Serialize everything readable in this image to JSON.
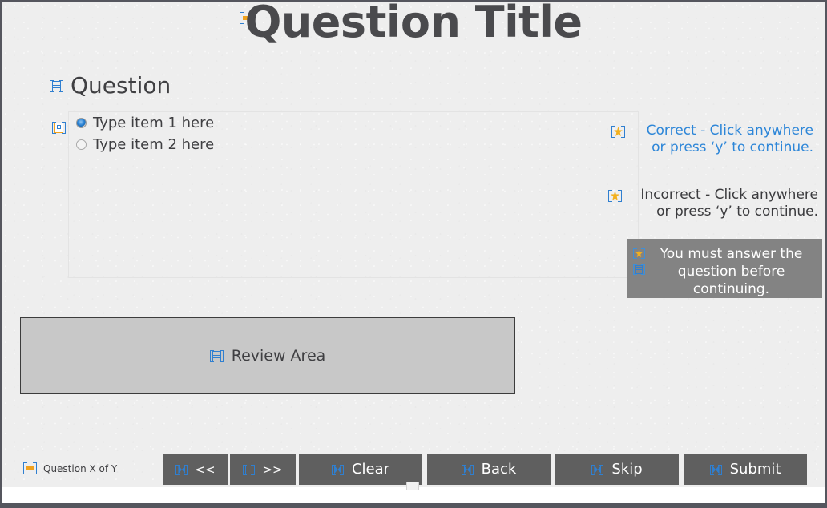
{
  "slide": {
    "title": "Question Title",
    "title_icon": "shape-object-icon"
  },
  "question": {
    "heading": "Question",
    "heading_icon": "text-block-icon",
    "answer_icon": "radio-group-icon",
    "choices": [
      {
        "label": "Type item 1 here",
        "selected": true
      },
      {
        "label": "Type item 2 here",
        "selected": false
      }
    ]
  },
  "feedback": {
    "correct": {
      "line1": "Correct - Click anywhere",
      "line2": "or press ‘y’ to continue.",
      "color": "#2d86d8",
      "icon": "caption-star-icon"
    },
    "incorrect": {
      "line1": "Incorrect - Click anywhere",
      "line2": "or press ‘y’ to continue.",
      "color": "#3b3b3e",
      "icon": "caption-star-icon"
    },
    "must_answer": {
      "line1": "You must answer the",
      "line2": "question before",
      "line3": "continuing.",
      "background": "#838383",
      "text_color": "#ffffff",
      "icon_star": "caption-star-icon",
      "icon_text": "text-block-icon"
    }
  },
  "review": {
    "label": "Review Area",
    "icon": "text-block-icon",
    "background": "#c8c8c8"
  },
  "footer": {
    "counter": "Question X of Y",
    "counter_icon": "shape-object-icon",
    "buttons": [
      {
        "label": "<<",
        "name": "prev",
        "icon": "button-object-icon"
      },
      {
        "label": ">>",
        "name": "next",
        "icon": "button-object-icon-hollow"
      },
      {
        "label": "Clear",
        "name": "clear",
        "icon": "button-object-icon"
      },
      {
        "label": "Back",
        "name": "back",
        "icon": "button-object-icon"
      },
      {
        "label": "Skip",
        "name": "skip",
        "icon": "button-object-icon"
      },
      {
        "label": "Submit",
        "name": "submit",
        "icon": "button-object-icon"
      }
    ],
    "button_color": "#5f5f5f",
    "button_text_color": "#ffffff"
  },
  "theme": {
    "canvas_background": "#eeeeee",
    "frame_color": "#55565e",
    "accent_blue": "#2f7fd0",
    "accent_orange": "#f0a21e",
    "heading_color": "#3f3f42"
  }
}
